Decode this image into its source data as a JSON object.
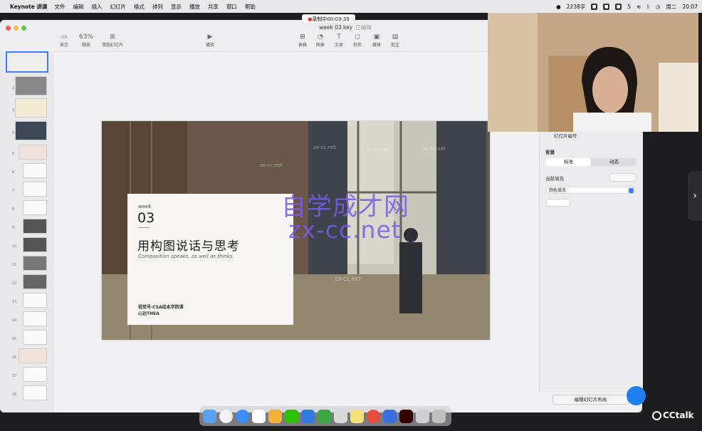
{
  "menubar": {
    "app_name": "Keynote 讲演",
    "items": [
      "文件",
      "编辑",
      "插入",
      "幻灯片",
      "格式",
      "排列",
      "显示",
      "播放",
      "共享",
      "窗口",
      "帮助"
    ],
    "word_count": "2238字",
    "battery_label": "5",
    "date": "周二",
    "time": "20:07"
  },
  "recording": {
    "label": "录制中00:03:35"
  },
  "window": {
    "doc_name": "week 03.key",
    "doc_status": "已编辑",
    "toolbar": {
      "display": "显示",
      "zoom": "63%",
      "zoom_label": "缩放",
      "add_slide": "添加幻灯片",
      "play": "播放",
      "table": "表格",
      "chart": "图表",
      "text": "文本",
      "shape": "形状",
      "media": "媒体",
      "comment": "批注"
    }
  },
  "navigator": {
    "slide_numbers": [
      "1",
      "2",
      "3",
      "4",
      "5",
      "6",
      "7",
      "8",
      "9",
      "10",
      "11",
      "12",
      "13",
      "14",
      "15",
      "16",
      "17",
      "18"
    ]
  },
  "slide": {
    "week": "week",
    "number": "03",
    "title": "用构图说话与思考",
    "subtitle": "Composition speaks, as well as thinks.",
    "footer_1": "视觉号·CSA绘本学院课",
    "footer_2": "心远THEA"
  },
  "watermarks": {
    "big_cn": "自学成才网",
    "big_en": "zx-cc.net",
    "small": "zx-cc.net",
    "small_alt": "ZX-CC.NET"
  },
  "inspector": {
    "slide_number_label": "幻灯片编号",
    "background_label": "背景",
    "tab_standard": "标准",
    "tab_dynamic": "动态",
    "current_fill": "当前填充",
    "fill_type": "颜色填充",
    "edit_layout": "编辑幻灯片布局"
  },
  "overlay": {
    "cctalk": "CCtalk"
  },
  "colors": {
    "accent": "#3a7ff6",
    "watermark": "#7a5ae6",
    "record_dot": "#e0332a"
  }
}
